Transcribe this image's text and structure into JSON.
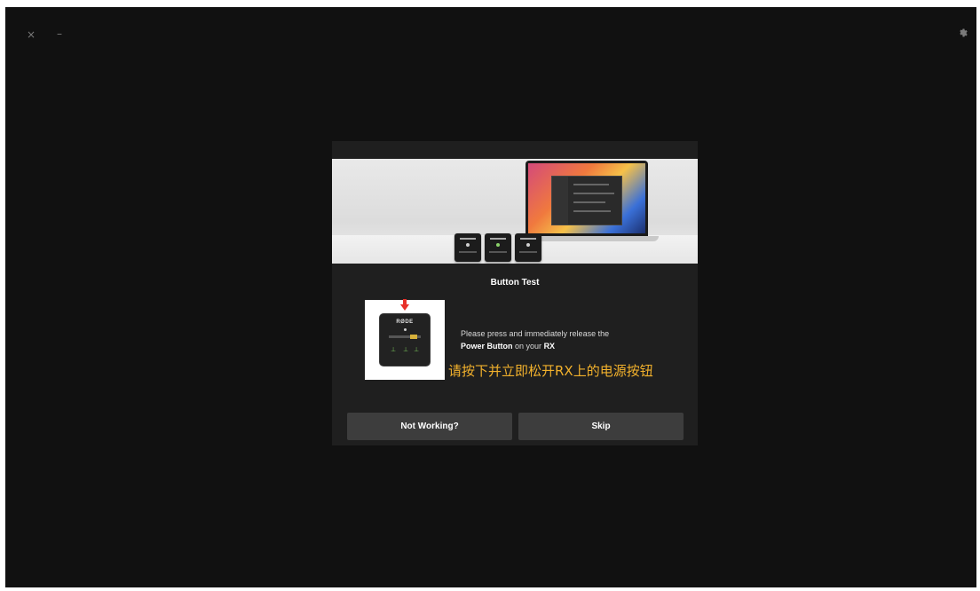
{
  "window": {
    "close_glyph": "×",
    "minimize_glyph": "–",
    "settings_icon": "gear-icon"
  },
  "dialog": {
    "title": "Button Test",
    "device_brand": "RØDE",
    "instruction_prefix": "Please press and immediately release the",
    "instruction_bold_1": "Power Button",
    "instruction_mid": "on your",
    "instruction_bold_2": "RX",
    "annotation_cn": "请按下并立即松开RX上的电源按钮",
    "buttons": {
      "not_working": "Not Working?",
      "skip": "Skip"
    }
  },
  "colors": {
    "app_background": "#111111",
    "dialog_background": "#1f1f1f",
    "button_background": "#3d3d3d",
    "annotation": "#f2b12c",
    "arrow": "#e8312a"
  }
}
